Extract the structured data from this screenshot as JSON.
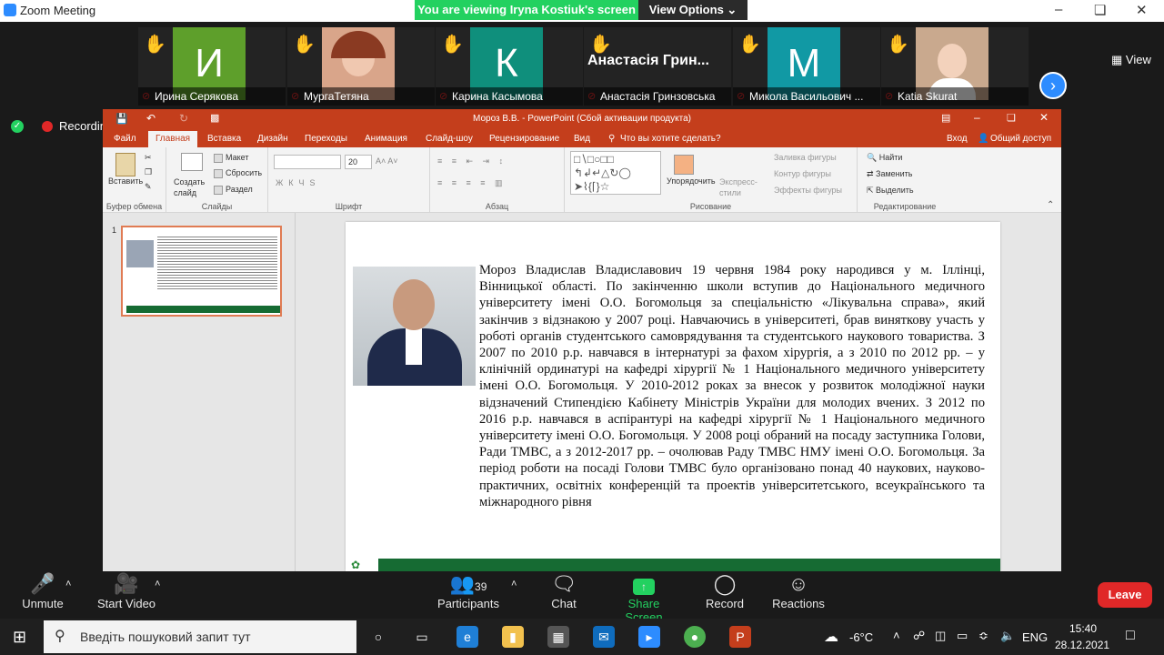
{
  "zoom": {
    "window_title": "Zoom Meeting",
    "banner": "You are viewing Iryna Kostiuk's screen",
    "view_options": "View Options ⌄",
    "view_label": "View",
    "recording_label": "Recording",
    "participants": [
      {
        "initial": "И",
        "name": "Ирина Серякова",
        "color": "#5e9f2b"
      },
      {
        "initial": "",
        "name": "МургаТетяна",
        "color": "#d9a58a"
      },
      {
        "initial": "К",
        "name": "Карина Касымова",
        "color": "#0f8f7c"
      },
      {
        "initial": "",
        "name": "Анастасія Гринзовська",
        "big_name": "Анастасія Грин...",
        "color": "#232323"
      },
      {
        "initial": "М",
        "name": "Микола Васильович ...",
        "color": "#1199a4"
      },
      {
        "initial": "",
        "name": "Katia Skurat",
        "color": "#c9a98e"
      }
    ],
    "toolbar": {
      "unmute": "Unmute",
      "start_video": "Start Video",
      "participants": "Participants",
      "participants_count": "39",
      "chat": "Chat",
      "share_screen": "Share Screen",
      "record": "Record",
      "reactions": "Reactions",
      "leave": "Leave"
    }
  },
  "powerpoint": {
    "title": "Мороз В.В. - PowerPoint (Сбой активации продукта)",
    "tabs": [
      "Файл",
      "Главная",
      "Вставка",
      "Дизайн",
      "Переходы",
      "Анимация",
      "Слайд-шоу",
      "Рецензирование",
      "Вид"
    ],
    "tell_me": "Что вы хотите сделать?",
    "signin": "Вход",
    "share": "Общий доступ",
    "ribbon": {
      "paste": "Вставить",
      "clipboard": "Буфер обмена",
      "create_slide": "Создать слайд",
      "layout": "Макет",
      "reset": "Сбросить",
      "section": "Раздел",
      "slides": "Слайды",
      "font_size": "20",
      "font": "Шрифт",
      "paragraph": "Абзац",
      "arrange": "Упорядочить",
      "express_styles": "Экспресс-стили",
      "shape_fill": "Заливка фигуры",
      "shape_outline": "Контур фигуры",
      "shape_effects": "Эффекты фигуры",
      "drawing": "Рисование",
      "find": "Найти",
      "replace": "Заменить",
      "select": "Выделить",
      "editing": "Редактирование"
    },
    "slide_number": "1",
    "slide_text": "Мороз Владислав Владиславович 19 червня 1984 року народився у м. Іллінці, Вінницької області. По закінченню школи вступив до Національного медичного університету імені О.О. Богомольця за спеціальністю «Лікувальна справа», який закінчив з відзнакою у 2007 році. Навчаючись в університеті, брав виняткову участь у роботі органів студентського самоврядування та студентського наукового товариства. З 2007 по 2010 р.р. навчався в інтернатурі за фахом хірургія, а з 2010 по 2012 рр. – у клінічній ординатурі на кафедрі хірургії № 1 Національного медичного університету імені О.О. Богомольця. У 2010-2012 роках за внесок у розвиток молодіжної науки відзначений Стипендією Кабінету Міністрів України для молодих вчених. З 2012 по 2016 р.р. навчався в аспірантурі на кафедрі хірургії № 1 Національного медичного університету імені О.О. Богомольця. У 2008 році обраний на посаду заступника Голови, Ради ТМВС, а з 2012-2017 рр. – очолював Раду ТМВС НМУ імені О.О. Богомольця. За період роботи на посаді Голови ТМВС було організовано понад 40 наукових, науково-практичних, освітніх конференцій та проектів університетського, всеукраїнського та міжнародного рівня"
  },
  "taskbar": {
    "search_placeholder": "Введіть пошуковий запит тут",
    "temperature": "-6°C",
    "language": "ENG",
    "time": "15:40",
    "date": "28.12.2021"
  }
}
